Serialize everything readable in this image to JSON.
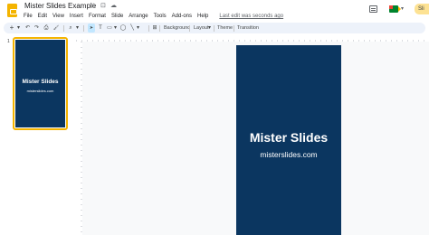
{
  "app": {
    "doc_title": "Mister Slides Example",
    "menu": [
      "File",
      "Edit",
      "View",
      "Insert",
      "Format",
      "Slide",
      "Arrange",
      "Tools",
      "Add-ons",
      "Help"
    ],
    "last_edit": "Last edit was seconds ago",
    "slideshow_label": "Sli"
  },
  "toolbar": {
    "new_slide": "+",
    "undo": "↶",
    "redo": "↷",
    "print": "⎙",
    "paint_format": "🖌",
    "zoom": "⌕",
    "select": "➤",
    "text_box": "T",
    "image": "▭",
    "shape": "◯",
    "line": "╲",
    "background_label": "Background",
    "layout_label": "Layout",
    "theme_label": "Theme",
    "transition_label": "Transition"
  },
  "filmstrip": {
    "slide_number": "1",
    "thumb_title": "Mister Slides",
    "thumb_subtitle": "misterslides.com"
  },
  "slide": {
    "title": "Mister Slides",
    "subtitle": "misterslides.com",
    "background_color": "#0b3660"
  },
  "colors": {
    "accent": "#f4b400",
    "toolbar_bg": "#edf2fa",
    "slideshow_bg": "#fde293"
  }
}
